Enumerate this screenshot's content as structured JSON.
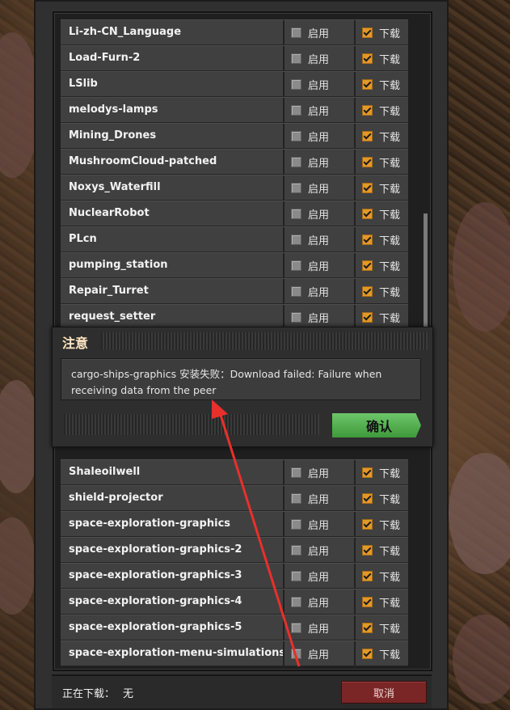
{
  "mods_top": [
    {
      "name": "Li-zh-CN_Language",
      "enabled": false,
      "download": true
    },
    {
      "name": "Load-Furn-2",
      "enabled": false,
      "download": true
    },
    {
      "name": "LSlib",
      "enabled": false,
      "download": true
    },
    {
      "name": "melodys-lamps",
      "enabled": false,
      "download": true
    },
    {
      "name": "Mining_Drones",
      "enabled": false,
      "download": true
    },
    {
      "name": "MushroomCloud-patched",
      "enabled": false,
      "download": true
    },
    {
      "name": "Noxys_Waterfill",
      "enabled": false,
      "download": true
    },
    {
      "name": "NuclearRobot",
      "enabled": false,
      "download": true
    },
    {
      "name": "PLcn",
      "enabled": false,
      "download": true
    },
    {
      "name": "pumping_station",
      "enabled": false,
      "download": true
    },
    {
      "name": "Repair_Turret",
      "enabled": false,
      "download": true
    },
    {
      "name": "request_setter",
      "enabled": false,
      "download": true
    }
  ],
  "mods_bottom": [
    {
      "name": "Shaleoilwell",
      "enabled": false,
      "download": true
    },
    {
      "name": "shield-projector",
      "enabled": false,
      "download": true
    },
    {
      "name": "space-exploration-graphics",
      "enabled": false,
      "download": true
    },
    {
      "name": "space-exploration-graphics-2",
      "enabled": false,
      "download": true
    },
    {
      "name": "space-exploration-graphics-3",
      "enabled": false,
      "download": true
    },
    {
      "name": "space-exploration-graphics-4",
      "enabled": false,
      "download": true
    },
    {
      "name": "space-exploration-graphics-5",
      "enabled": false,
      "download": true
    },
    {
      "name": "space-exploration-menu-simulations",
      "enabled": false,
      "download": true
    }
  ],
  "columns": {
    "enable_label": "启用",
    "download_label": "下载"
  },
  "notice": {
    "title": "注意",
    "message": "cargo-ships-graphics 安装失败：Download failed: Failure when receiving data from the peer",
    "confirm_label": "确认"
  },
  "footer": {
    "downloading_label": "正在下载：",
    "downloading_value": "无",
    "cancel_label": "取消"
  },
  "colors": {
    "accent_checkbox": "#e39827",
    "confirm_green": "#5bb657",
    "cancel_red": "#7a2626",
    "arrow": "#e8302a"
  }
}
